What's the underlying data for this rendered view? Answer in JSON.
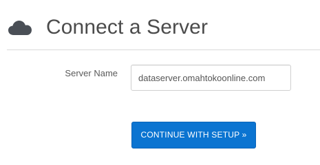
{
  "header": {
    "icon": "cloud-icon",
    "title": "Connect a Server"
  },
  "form": {
    "server_name_label": "Server Name",
    "server_name_value": "dataserver.omahtokoonline.com"
  },
  "actions": {
    "continue_label": "CONTINUE WITH SETUP »"
  },
  "colors": {
    "title_text": "#4b4b4b",
    "icon": "#4a4f56",
    "button_bg": "#0b74d1",
    "button_text": "#ffffff",
    "divider": "#d9d9d9"
  }
}
